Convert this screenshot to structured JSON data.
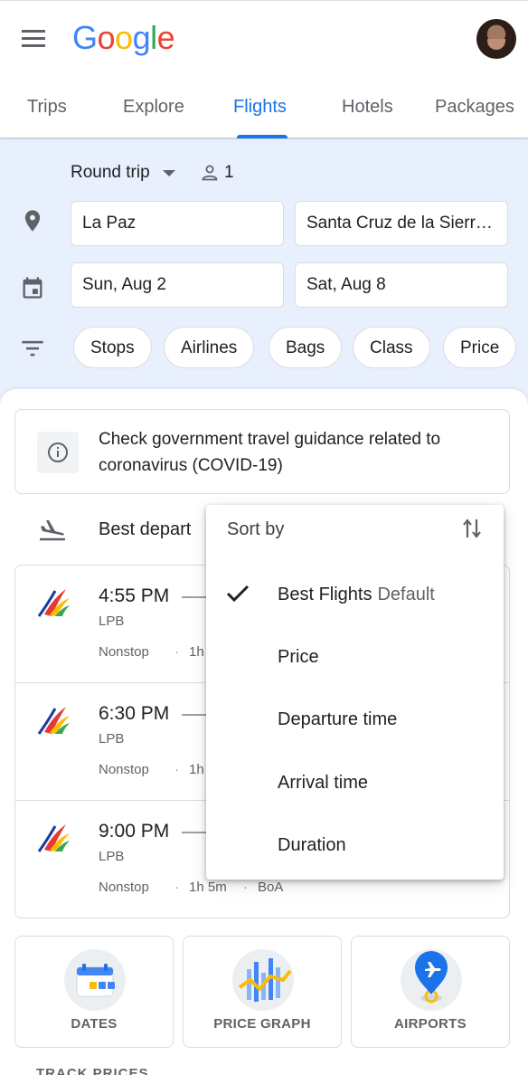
{
  "header": {
    "logo_letters": [
      "G",
      "o",
      "o",
      "g",
      "l",
      "e"
    ]
  },
  "tabs": [
    {
      "label": "Trips"
    },
    {
      "label": "Explore"
    },
    {
      "label": "Flights"
    },
    {
      "label": "Hotels"
    },
    {
      "label": "Packages"
    }
  ],
  "search": {
    "trip_type": "Round trip",
    "passengers": "1",
    "origin": "La Paz",
    "destination": "Santa Cruz de la Sierr…",
    "depart_date": "Sun, Aug 2",
    "return_date": "Sat, Aug 8",
    "filters": [
      "Stops",
      "Airlines",
      "Bags",
      "Class",
      "Price"
    ]
  },
  "notice": {
    "text": "Check government travel guidance related to coronavirus (COVID-19)"
  },
  "sort_row": {
    "label": "Best depart"
  },
  "flights": [
    {
      "time": "4:55 PM",
      "code": "LPB",
      "stops": "Nonstop",
      "duration": "1h",
      "airline": ""
    },
    {
      "time": "6:30 PM",
      "code": "LPB",
      "stops": "Nonstop",
      "duration": "1h",
      "airline": ""
    },
    {
      "time": "9:00 PM",
      "code": "LPB",
      "stops": "Nonstop",
      "duration": "1h 5m",
      "airline": "BoA"
    }
  ],
  "tiles": [
    {
      "label": "DATES",
      "icon": "calendar-icon"
    },
    {
      "label": "PRICE GRAPH",
      "icon": "price-graph-icon"
    },
    {
      "label": "AIRPORTS",
      "icon": "airport-pin-icon"
    }
  ],
  "track_prices": "TRACK PRICES",
  "sort_menu": {
    "title": "Sort by",
    "items": [
      {
        "label": "Best Flights",
        "suffix": "Default",
        "selected": true
      },
      {
        "label": "Price"
      },
      {
        "label": "Departure time"
      },
      {
        "label": "Arrival time"
      },
      {
        "label": "Duration"
      }
    ]
  },
  "colors": {
    "accent": "#1a73e8",
    "search_bg": "#e8f0fe",
    "google_blue": "#4285f4",
    "google_red": "#ea4335",
    "google_yellow": "#fbbc05",
    "google_green": "#34a853"
  }
}
